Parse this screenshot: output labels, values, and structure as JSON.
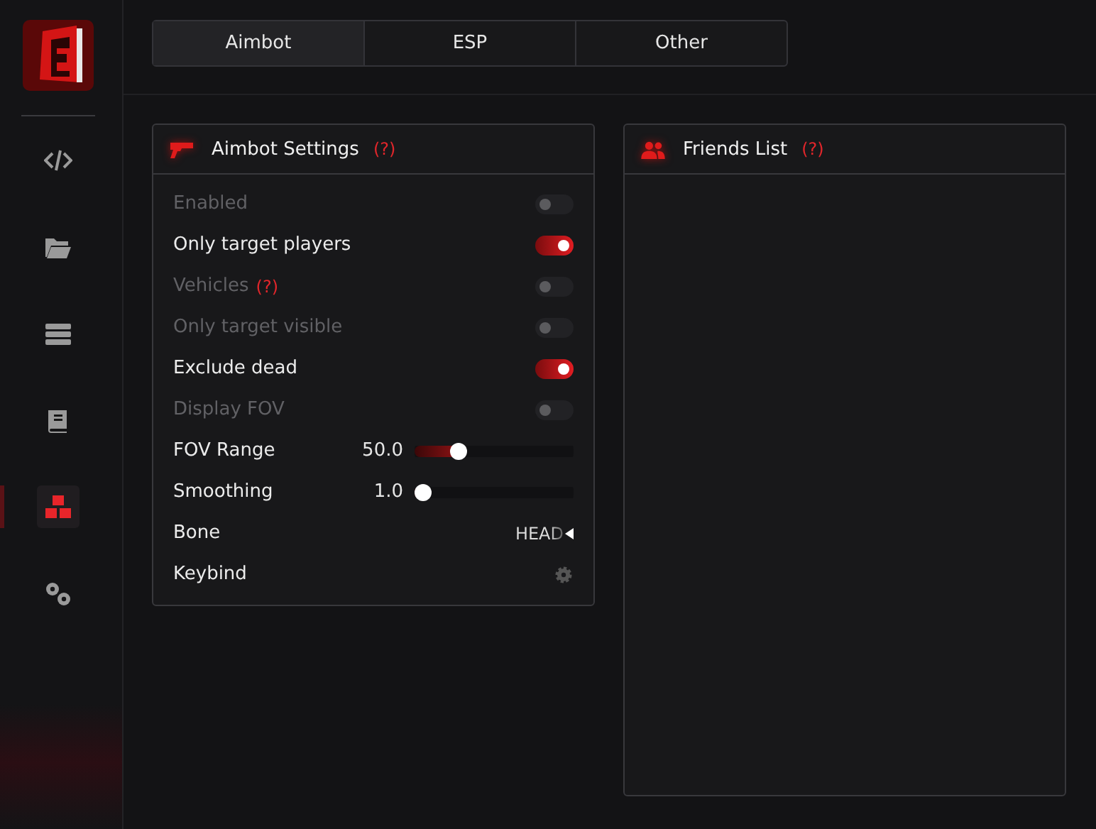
{
  "sidebar": {
    "items": [
      {
        "selected": false
      },
      {
        "selected": false
      },
      {
        "selected": false
      },
      {
        "selected": false
      },
      {
        "selected": true
      },
      {
        "selected": false
      }
    ]
  },
  "tabs": [
    {
      "label": "Aimbot",
      "selected": true
    },
    {
      "label": "ESP",
      "selected": false
    },
    {
      "label": "Other",
      "selected": false
    }
  ],
  "aimbot_settings": {
    "title": "Aimbot Settings",
    "help": "(?)",
    "rows": [
      {
        "kind": "toggle",
        "label": "Enabled",
        "disabled": true,
        "on": false
      },
      {
        "kind": "toggle",
        "label": "Only target players",
        "disabled": false,
        "on": true
      },
      {
        "kind": "toggle",
        "label": "Vehicles",
        "help": "(?)",
        "disabled": true,
        "on": false
      },
      {
        "kind": "toggle",
        "label": "Only target visible",
        "disabled": true,
        "on": false
      },
      {
        "kind": "toggle",
        "label": "Exclude dead",
        "disabled": false,
        "on": true
      },
      {
        "kind": "toggle",
        "label": "Display FOV",
        "disabled": true,
        "on": false
      },
      {
        "kind": "slider",
        "label": "FOV Range",
        "value": "50.0",
        "level": 0.25
      },
      {
        "kind": "slider",
        "label": "Smoothing",
        "value": "1.0",
        "level": 0.0
      },
      {
        "kind": "select",
        "label": "Bone",
        "value": "HEAD"
      },
      {
        "kind": "keybind",
        "label": "Keybind"
      }
    ]
  },
  "friends_list": {
    "title": "Friends List",
    "help": "(?)"
  }
}
